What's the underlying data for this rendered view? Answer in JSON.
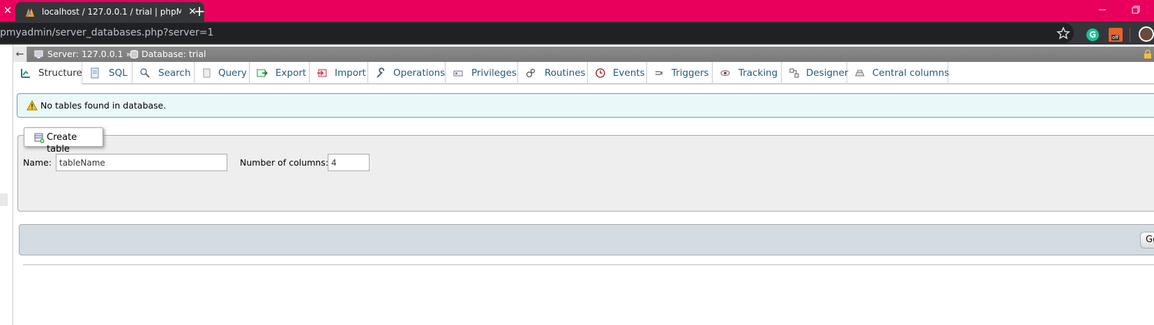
{
  "browser": {
    "tab_title": "localhost / 127.0.0.1 / trial | phpM",
    "url": "pmyadmin/server_databases.php?server=1",
    "extension_off_badge": "off",
    "grammarly_letter": "G"
  },
  "breadcrumb": {
    "server_label": "Server: 127.0.0.1 »",
    "database_label": "Database: trial"
  },
  "menu": {
    "tabs": [
      {
        "label": "Structure",
        "icon": "structure-icon",
        "active": true
      },
      {
        "label": "SQL",
        "icon": "sql-icon"
      },
      {
        "label": "Search",
        "icon": "search-icon"
      },
      {
        "label": "Query",
        "icon": "query-icon"
      },
      {
        "label": "Export",
        "icon": "export-icon"
      },
      {
        "label": "Import",
        "icon": "import-icon"
      },
      {
        "label": "Operations",
        "icon": "wrench-icon"
      },
      {
        "label": "Privileges",
        "icon": "privileges-icon"
      },
      {
        "label": "Routines",
        "icon": "routines-icon"
      },
      {
        "label": "Events",
        "icon": "clock-icon"
      },
      {
        "label": "Triggers",
        "icon": "triggers-icon"
      },
      {
        "label": "Tracking",
        "icon": "eye-icon"
      },
      {
        "label": "Designer",
        "icon": "designer-icon"
      },
      {
        "label": "Central columns",
        "icon": "central-columns-icon"
      }
    ]
  },
  "notice": {
    "text": "No tables found in database."
  },
  "create_table": {
    "legend": "Create table",
    "name_label": "Name:",
    "name_value": "tableName",
    "columns_label": "Number of columns:",
    "columns_value": "4",
    "go_label": "Go"
  },
  "colors": {
    "titlebar": "#e8005c",
    "link": "#235a81",
    "notice_bg": "#ebf8fa"
  }
}
